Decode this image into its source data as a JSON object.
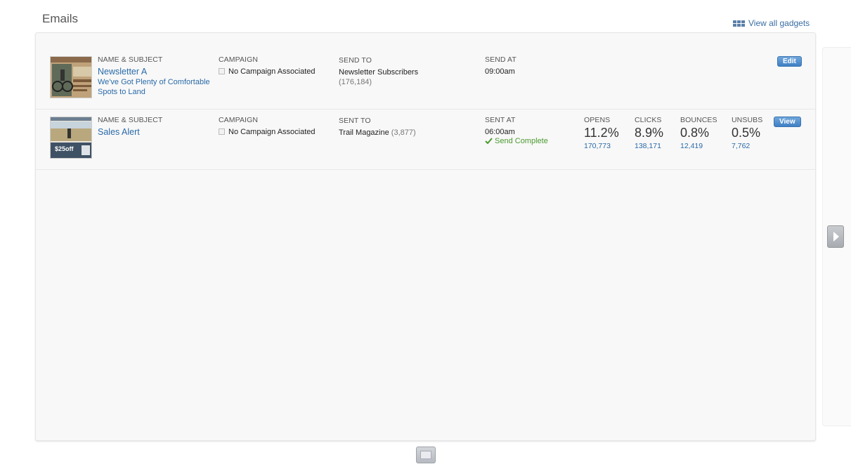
{
  "page": {
    "title": "Emails",
    "view_all_label": "View all gadgets"
  },
  "emails": [
    {
      "name_label": "NAME & SUBJECT",
      "name": "Newsletter A",
      "subject": "We've Got Plenty of Comfortable Spots to Land",
      "campaign_label": "CAMPAIGN",
      "campaign": "No Campaign Associated",
      "send_to_label": "SEND TO",
      "send_to": "Newsletter Subscribers",
      "send_to_count": "(176,184)",
      "send_at_label": "SEND AT",
      "send_at": "09:00am",
      "action": "Edit"
    },
    {
      "name_label": "NAME & SUBJECT",
      "name": "Sales Alert",
      "campaign_label": "CAMPAIGN",
      "campaign": "No Campaign Associated",
      "send_to_label": "SENT TO",
      "send_to": "Trail Magazine",
      "send_to_count": "(3,877)",
      "send_at_label": "SENT AT",
      "send_at": "06:00am",
      "status": "Send Complete",
      "thumb_text": "$25off",
      "stats": [
        {
          "label": "OPENS",
          "pct": "11.2%",
          "count": "170,773"
        },
        {
          "label": "CLICKS",
          "pct": "8.9%",
          "count": "138,171"
        },
        {
          "label": "BOUNCES",
          "pct": "0.8%",
          "count": "12,419"
        },
        {
          "label": "UNSUBS",
          "pct": "0.5%",
          "count": "7,762"
        }
      ],
      "action": "View"
    }
  ],
  "colors": {
    "link": "#2a6aa8",
    "button": "#4a88cc",
    "success": "#4a9a2e"
  },
  "icons": [
    "grid-icon",
    "checkbox-icon",
    "checkmark-icon",
    "chevron-right-icon",
    "page-indicator-icon"
  ]
}
